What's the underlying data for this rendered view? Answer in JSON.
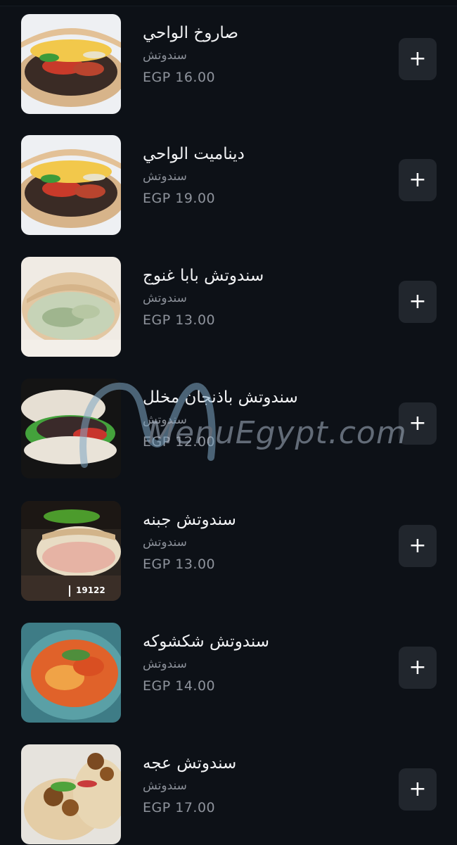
{
  "menu": {
    "items": [
      {
        "name": "صاروخ الواحي",
        "category": "سندوتش",
        "price": "EGP 16.00",
        "add_label": "+"
      },
      {
        "name": "ديناميت الواحي",
        "category": "سندوتش",
        "price": "EGP 19.00",
        "add_label": "+"
      },
      {
        "name": "سندوتش بابا غنوج",
        "category": "سندوتش",
        "price": "EGP 13.00",
        "add_label": "+"
      },
      {
        "name": "سندوتش باذنجان مخلل",
        "category": "سندوتش",
        "price": "EGP 12.00",
        "add_label": "+"
      },
      {
        "name": "سندوتش جبنه",
        "category": "سندوتش",
        "price": "EGP 13.00",
        "add_label": "+"
      },
      {
        "name": "سندوتش شكشوكه",
        "category": "سندوتش",
        "price": "EGP 14.00",
        "add_label": "+"
      },
      {
        "name": "سندوتش عجه",
        "category": "سندوتش",
        "price": "EGP 17.00",
        "add_label": "+"
      }
    ]
  },
  "watermark": {
    "text": "MenuEgypt.com"
  },
  "images": {
    "item0": "sandwich-photo",
    "item1": "sandwich-photo",
    "item2": "pita-photo",
    "item3": "eggplant-sandwich-photo",
    "item4": "cheese-pita-photo",
    "item5": "shakshuka-photo",
    "item6": "falafel-wrap-photo",
    "item4_badge": "19122"
  },
  "colors": {
    "background": "#0d1117",
    "button": "#21262d",
    "text_primary": "#f2f3f5",
    "text_secondary": "#8b9099"
  }
}
